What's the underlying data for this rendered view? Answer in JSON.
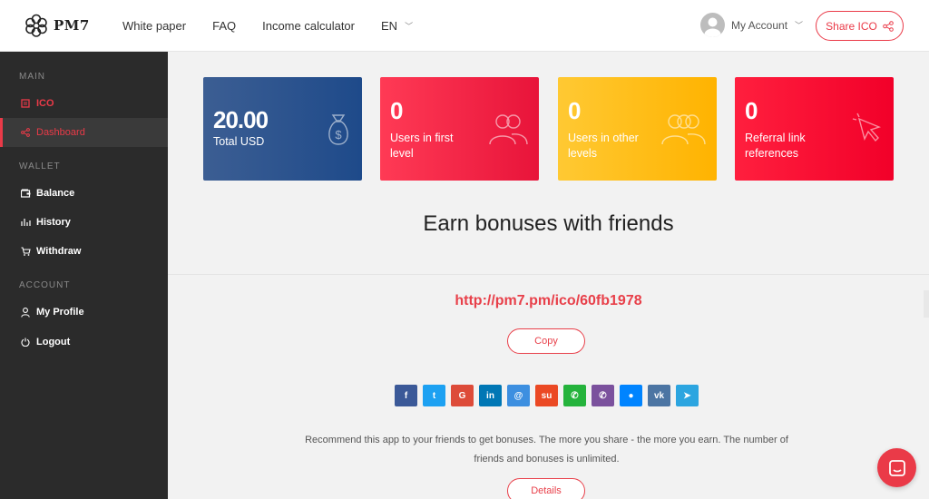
{
  "brand": {
    "name": "PM7"
  },
  "nav": {
    "white_paper": "White paper",
    "faq": "FAQ",
    "income_calculator": "Income calculator",
    "language": "EN"
  },
  "account": {
    "label": "My Account"
  },
  "share_button": {
    "label": "Share ICO"
  },
  "sidebar": {
    "main_label": "MAIN",
    "ico": "ICO",
    "dashboard": "Dashboard",
    "wallet_label": "WALLET",
    "balance": "Balance",
    "history": "History",
    "withdraw": "Withdraw",
    "account_label": "ACCOUNT",
    "my_profile": "My Profile",
    "logout": "Logout"
  },
  "cards": {
    "total": {
      "value": "20.00",
      "label": "Total USD"
    },
    "first_level": {
      "value": "0",
      "label": "Users in first level"
    },
    "other_levels": {
      "value": "0",
      "label": "Users in other levels"
    },
    "referral": {
      "value": "0",
      "label": "Referral link references"
    }
  },
  "earn": {
    "title": "Earn bonuses with friends",
    "link": "http://pm7.pm/ico/60fb1978",
    "copy_label": "Copy",
    "recommend_text": "Recommend this app to your friends to get bonuses. The more you share - the more you earn. The number of friends and bonuses is unlimited.",
    "details_label": "Details"
  },
  "socials": {
    "facebook": {
      "glyph": "f",
      "color": "#3b5998"
    },
    "twitter": {
      "glyph": "t",
      "color": "#1da1f2"
    },
    "google": {
      "glyph": "G",
      "color": "#dd4b39"
    },
    "linkedin": {
      "glyph": "in",
      "color": "#0077b5"
    },
    "email": {
      "glyph": "@",
      "color": "#3d8fe0"
    },
    "stumbleupon": {
      "glyph": "su",
      "color": "#eb4924"
    },
    "whatsapp": {
      "glyph": "✆",
      "color": "#25b33c"
    },
    "viber": {
      "glyph": "✆",
      "color": "#7b519d"
    },
    "messenger": {
      "glyph": "●",
      "color": "#0084ff"
    },
    "vk": {
      "glyph": "vk",
      "color": "#4c75a3"
    },
    "telegram": {
      "glyph": "➤",
      "color": "#2ca5e0"
    }
  },
  "colors": {
    "accent": "#ea3a48",
    "sidebar_bg": "#2b2b2b",
    "card_blue": "#2a5189",
    "card_pink": "#f5253f",
    "card_yellow": "#ffbd1a",
    "card_red": "#f80a32"
  }
}
